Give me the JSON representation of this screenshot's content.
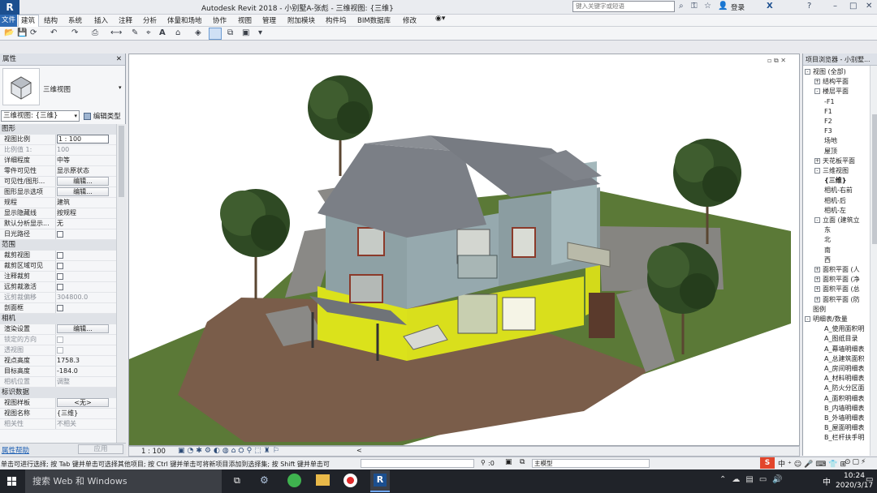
{
  "app": {
    "title": "Autodesk Revit 2018 -    小别墅A-张彪 - 三维视图: {三维}",
    "search_placeholder": "键入关键字或短语",
    "login": "登录"
  },
  "ribbon_tabs": [
    {
      "label": "文件",
      "active": false
    },
    {
      "label": "建筑",
      "active": true
    },
    {
      "label": "结构",
      "active": false
    },
    {
      "label": "系统",
      "active": false
    },
    {
      "label": "插入",
      "active": false
    },
    {
      "label": "注释",
      "active": false
    },
    {
      "label": "分析",
      "active": false
    },
    {
      "label": "体量和场地",
      "active": false
    },
    {
      "label": "协作",
      "active": false
    },
    {
      "label": "视图",
      "active": false
    },
    {
      "label": "管理",
      "active": false
    },
    {
      "label": "附加模块",
      "active": false
    },
    {
      "label": "构件坞",
      "active": false
    },
    {
      "label": "BIM数据库",
      "active": false
    },
    {
      "label": "修改",
      "active": false
    }
  ],
  "properties": {
    "title": "属性",
    "type_name": "三维视图",
    "selector": "三维视图: {三维}",
    "edit_type": "编辑类型",
    "sections": {
      "graphics": "图形",
      "extents": "范围",
      "camera": "相机",
      "identity": "标识数据"
    },
    "rows": {
      "view_scale": {
        "key": "视图比例",
        "value": "1 : 100"
      },
      "scale_value": {
        "key": "比例值 1:",
        "value": "100"
      },
      "detail_level": {
        "key": "详细程度",
        "value": "中等"
      },
      "parts_visibility": {
        "key": "零件可见性",
        "value": "显示原状态"
      },
      "vg_overrides": {
        "key": "可见性/图形...",
        "value": "编辑..."
      },
      "graphic_display": {
        "key": "图形显示选项",
        "value": "编辑..."
      },
      "discipline": {
        "key": "规程",
        "value": "建筑"
      },
      "show_hidden": {
        "key": "显示隐藏线",
        "value": "按规程"
      },
      "default_analysis": {
        "key": "默认分析显示...",
        "value": "无"
      },
      "sun_path": {
        "key": "日光路径",
        "value": ""
      },
      "crop_view": {
        "key": "裁剪视图",
        "value": ""
      },
      "crop_visible": {
        "key": "裁剪区域可见",
        "value": ""
      },
      "annotation_crop": {
        "key": "注释裁剪",
        "value": ""
      },
      "far_clip_active": {
        "key": "远剪裁激活",
        "value": ""
      },
      "far_clip_offset": {
        "key": "远剪裁偏移",
        "value": "304800.0"
      },
      "section_box": {
        "key": "剖面框",
        "value": ""
      },
      "render_settings": {
        "key": "渲染设置",
        "value": "编辑..."
      },
      "locked_orientation": {
        "key": "锁定的方向",
        "value": ""
      },
      "perspective": {
        "key": "透视图",
        "value": ""
      },
      "eye_elevation": {
        "key": "视点高度",
        "value": "1758.3"
      },
      "target_elevation": {
        "key": "目标高度",
        "value": "-184.0"
      },
      "camera_position": {
        "key": "相机位置",
        "value": "调整"
      },
      "view_template": {
        "key": "视图样板",
        "value": "<无>"
      },
      "view_name": {
        "key": "视图名称",
        "value": "{三维}"
      },
      "dependency": {
        "key": "相关性",
        "value": "不相关"
      }
    },
    "help": "属性帮助",
    "apply": "应用"
  },
  "project_browser": {
    "title": "项目浏览器 - 小别墅...",
    "items": [
      {
        "label": "视图 (全部)",
        "level": 0,
        "toggle": "-"
      },
      {
        "label": "结构平面",
        "level": 1,
        "toggle": "+"
      },
      {
        "label": "楼层平面",
        "level": 1,
        "toggle": "-"
      },
      {
        "label": "-F1",
        "level": 2,
        "toggle": ""
      },
      {
        "label": "F1",
        "level": 2,
        "toggle": ""
      },
      {
        "label": "F2",
        "level": 2,
        "toggle": ""
      },
      {
        "label": "F3",
        "level": 2,
        "toggle": ""
      },
      {
        "label": "场地",
        "level": 2,
        "toggle": ""
      },
      {
        "label": "屋顶",
        "level": 2,
        "toggle": ""
      },
      {
        "label": "天花板平面",
        "level": 1,
        "toggle": "+"
      },
      {
        "label": "三维视图",
        "level": 1,
        "toggle": "-"
      },
      {
        "label": "{三维}",
        "level": 2,
        "toggle": "",
        "bold": true
      },
      {
        "label": "相机-右前",
        "level": 2,
        "toggle": ""
      },
      {
        "label": "相机-后",
        "level": 2,
        "toggle": ""
      },
      {
        "label": "相机-左",
        "level": 2,
        "toggle": ""
      },
      {
        "label": "立面 (建筑立",
        "level": 1,
        "toggle": "-"
      },
      {
        "label": "东",
        "level": 2,
        "toggle": ""
      },
      {
        "label": "北",
        "level": 2,
        "toggle": ""
      },
      {
        "label": "南",
        "level": 2,
        "toggle": ""
      },
      {
        "label": "西",
        "level": 2,
        "toggle": ""
      },
      {
        "label": "面积平面 (人",
        "level": 1,
        "toggle": "+"
      },
      {
        "label": "面积平面 (净",
        "level": 1,
        "toggle": "+"
      },
      {
        "label": "面积平面 (总",
        "level": 1,
        "toggle": "+"
      },
      {
        "label": "面积平面 (防",
        "level": 1,
        "toggle": "+"
      },
      {
        "label": "图例",
        "level": 0,
        "toggle": ""
      },
      {
        "label": "明细表/数量",
        "level": 0,
        "toggle": "-"
      },
      {
        "label": "A_使用面积明",
        "level": 2,
        "toggle": ""
      },
      {
        "label": "A_图纸目录",
        "level": 2,
        "toggle": ""
      },
      {
        "label": "A_幕墙明细表",
        "level": 2,
        "toggle": ""
      },
      {
        "label": "A_总建筑面积",
        "level": 2,
        "toggle": ""
      },
      {
        "label": "A_房间明细表",
        "level": 2,
        "toggle": ""
      },
      {
        "label": "A_材料明细表",
        "level": 2,
        "toggle": ""
      },
      {
        "label": "A_防火分区面",
        "level": 2,
        "toggle": ""
      },
      {
        "label": "A_面积明细表",
        "level": 2,
        "toggle": ""
      },
      {
        "label": "B_内墙明细表",
        "level": 2,
        "toggle": ""
      },
      {
        "label": "B_外墙明细表",
        "level": 2,
        "toggle": ""
      },
      {
        "label": "B_屋面明细表",
        "level": 2,
        "toggle": ""
      },
      {
        "label": "B_栏杆扶手明",
        "level": 2,
        "toggle": ""
      }
    ]
  },
  "view_control": {
    "scale": "1 : 100"
  },
  "status": {
    "hint": "单击可进行选择; 按 Tab 键并单击可选择其他项目; 按 Ctrl 键并单击可将新项目添加到选择集; 按 Shift 键并单击可",
    "selection_count": ":0",
    "model": "主模型"
  },
  "taskbar": {
    "search": "搜索 Web 和 Windows",
    "time": "10:24",
    "date": "2020/3/17",
    "ime": "中"
  },
  "colors": {
    "lawn": "#5d7a38",
    "dirt": "#7b5e4a",
    "wall": "#8fa2a6",
    "accent_yellow": "#dce31a",
    "roof": "#7c8086"
  }
}
